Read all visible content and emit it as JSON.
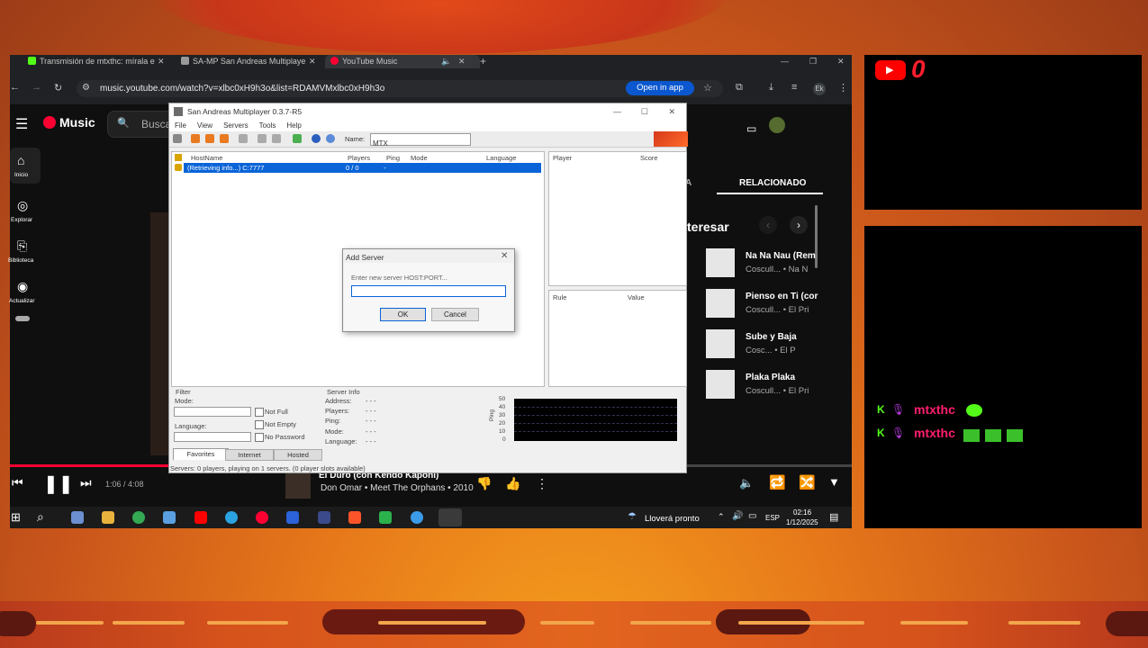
{
  "browser": {
    "tabs": [
      {
        "label": "Transmisión de mtxthc: mírala e",
        "color": "#53fc18"
      },
      {
        "label": "SA-MP San Andreas Multiplaye",
        "color": "#bbbbbb"
      },
      {
        "label": "YouTube Music",
        "color": "#ff0033"
      }
    ],
    "new_tab": "+",
    "url": "music.youtube.com/watch?v=xlbc0xH9h3o&list=RDAMVMxlbc0xH9h3o",
    "open_in_app": "Open in app",
    "profile": "Ek"
  },
  "ytmusic": {
    "logo": "Music",
    "search_placeholder": "Busca",
    "nav": [
      "Inicio",
      "Explorar",
      "Biblioteca",
      "Actualizar"
    ],
    "tab_partial": "A",
    "tab_related": "RELACIONADO",
    "section_partial": "teresar",
    "songs": [
      {
        "title": "Na Na Nau (Rem",
        "artist": "Coscull... • Na N"
      },
      {
        "title": "Pienso en Ti (cor",
        "artist": "Coscull... • El Pri"
      },
      {
        "title": "Sube y Baja",
        "artist": "Cosc... • El P"
      },
      {
        "title": "Plaka Plaka",
        "artist": "Coscull... • El Pri"
      }
    ],
    "player": {
      "time": "1:06 / 4:08",
      "track": "El Duro (con Kendo Kaponi)",
      "meta": "Don Omar • Meet The Orphans • 2010",
      "progress": 0.27
    }
  },
  "samp": {
    "title": "San Andreas Multiplayer 0.3.7-R5",
    "menu": [
      "File",
      "View",
      "Servers",
      "Tools",
      "Help"
    ],
    "name_label": "Name:",
    "name_value": "MTX",
    "columns": [
      "HostName",
      "Players",
      "Ping",
      "Mode",
      "Language"
    ],
    "row": {
      "host": "(Retrieving info...) C:7777",
      "players": "0 / 0",
      "ping": "-"
    },
    "player_cols": [
      "Player",
      "Score"
    ],
    "rule_cols": [
      "Rule",
      "Value"
    ],
    "filter": {
      "title": "Filter",
      "mode": "Mode:",
      "language": "Language:",
      "not_full": "Not Full",
      "not_empty": "Not Empty",
      "no_password": "No Password"
    },
    "server_info": {
      "title": "Server Info",
      "labels": [
        "Address:",
        "Players:",
        "Ping:",
        "Mode:",
        "Language:"
      ],
      "values": [
        "- - -",
        "- - -",
        "- - -",
        "- - -",
        "- - -"
      ]
    },
    "ping_axis": [
      "50",
      "40",
      "30",
      "20",
      "10",
      "0"
    ],
    "ping_label": "Ping",
    "tabs": [
      "Favorites",
      "Internet",
      "Hosted"
    ],
    "status": "Servers: 0 players, playing on 1 servers. (0 player slots available)"
  },
  "dialog": {
    "title": "Add Server",
    "prompt": "Enter new server HOST:PORT...",
    "ok": "OK",
    "cancel": "Cancel"
  },
  "taskbar": {
    "weather": "Lloverá pronto",
    "lang": "ESP",
    "time": "02:16",
    "date": "1/12/2025"
  },
  "overlay": {
    "counter": "0",
    "chat": [
      {
        "user": "mtxthc",
        "badge": "K"
      },
      {
        "user": "mtxthc",
        "badge": "K"
      }
    ]
  }
}
